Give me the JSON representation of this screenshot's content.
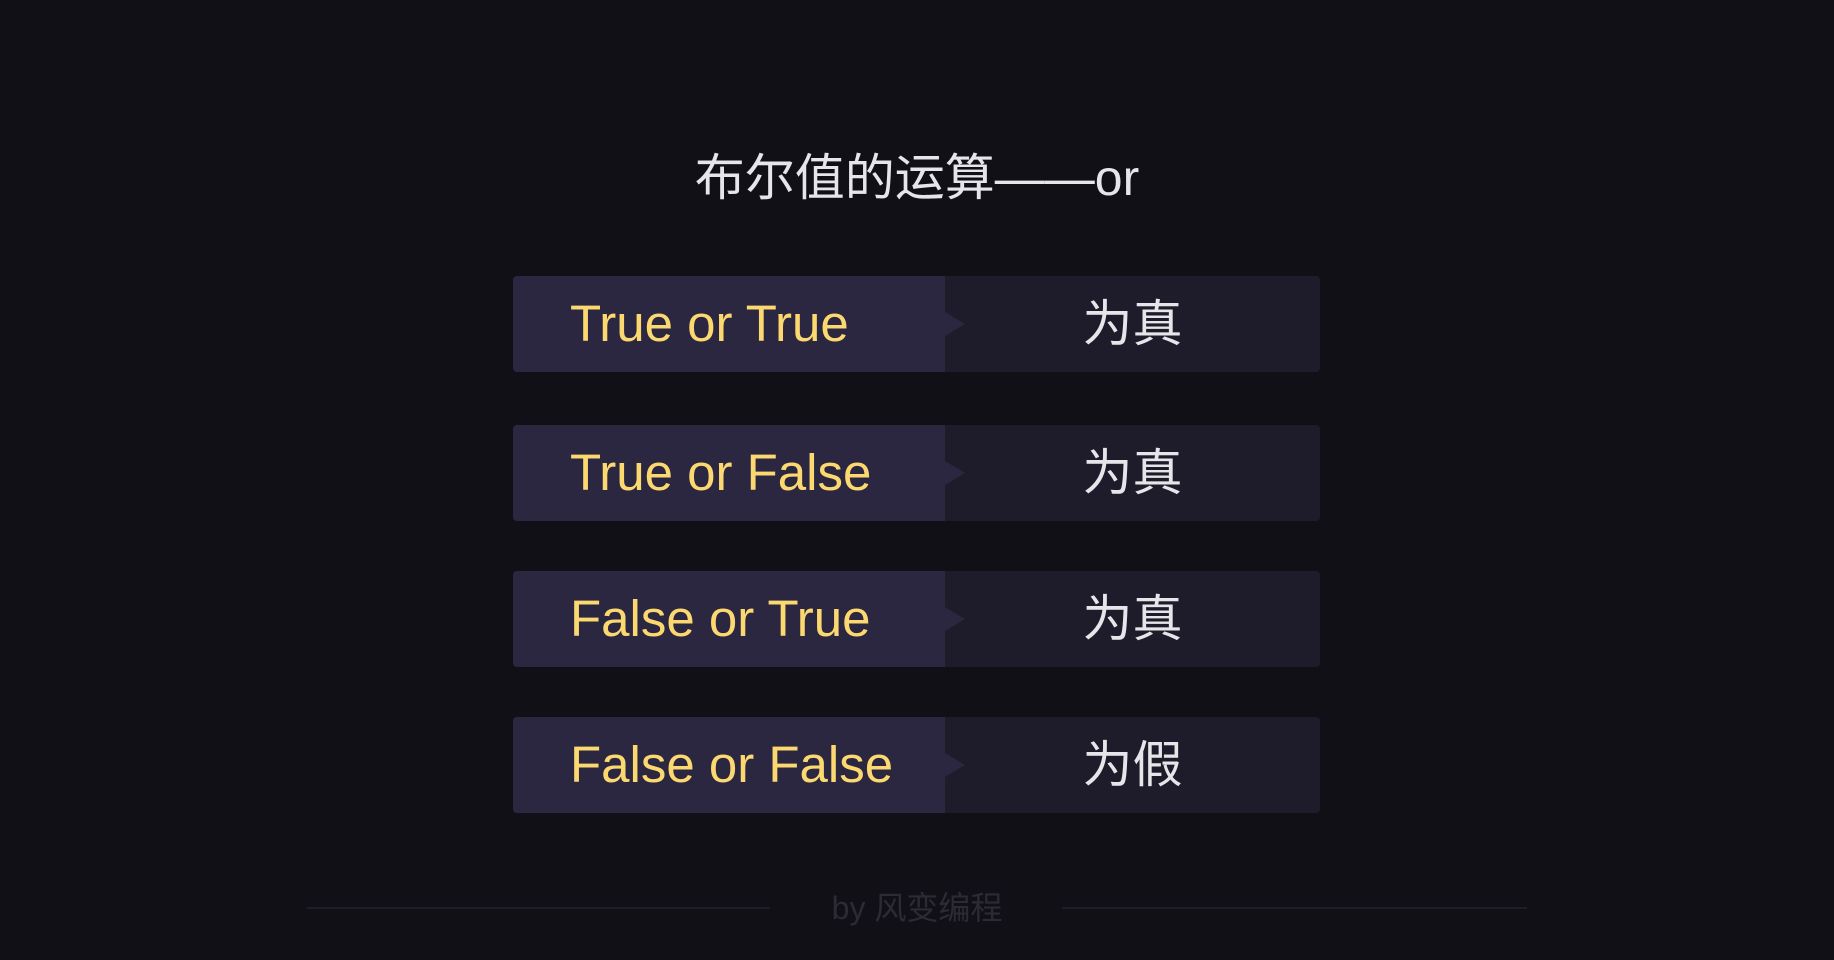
{
  "title": "布尔值的运算——or",
  "rows": [
    {
      "expression": "True or True",
      "result": "为真"
    },
    {
      "expression": "True or False",
      "result": "为真"
    },
    {
      "expression": "False or True",
      "result": "为真"
    },
    {
      "expression": "False or False",
      "result": "为假"
    }
  ],
  "footer": "by 风变编程",
  "colors": {
    "background": "#111016",
    "expression_text": "#fcd870",
    "left_panel": "#2b2740",
    "right_panel": "#1e1c2a"
  }
}
